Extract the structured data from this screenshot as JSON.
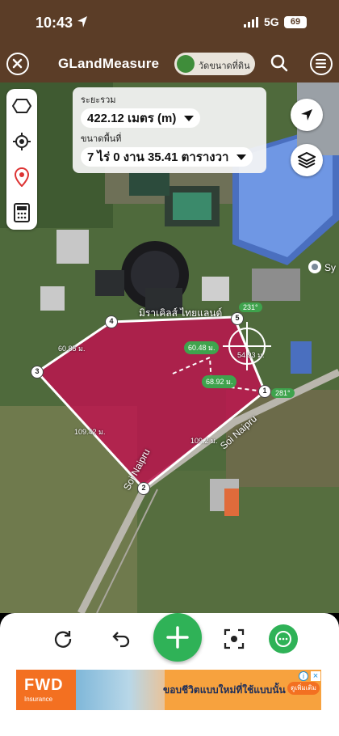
{
  "status": {
    "time": "10:43",
    "network": "5G",
    "battery": "69"
  },
  "app": {
    "title": "GLandMeasure",
    "mode_pill": "วัดขนาดที่ดิน"
  },
  "info_panel": {
    "total_label": "ระยะรวม",
    "total_value": "422.12 เมตร (m)",
    "area_label": "ขนาดพื้นที่",
    "area_value": "7 ไร่ 0 งาน 35.41 ตารางวา"
  },
  "polygon": {
    "vertices": [
      "1",
      "2",
      "3",
      "4",
      "5"
    ],
    "edges": [
      "60.85 ม.",
      "109.42 ม.",
      "109.2 ม.",
      "54.93 ม.",
      "60.48 ม.",
      "68.92 ม."
    ],
    "angles": [
      "281°",
      "231°"
    ]
  },
  "map_labels": {
    "road": "Soi Naipru",
    "road2": "Soi Naipru",
    "place": "มิราเคิลส์ ไทยแลนด์",
    "place2": "Sy"
  },
  "ad": {
    "brand": "FWD",
    "brand_sub": "Insurance",
    "text": "ขอบชีวิตแบบใหม่ที่ใช้แบบนั้น",
    "cta": "ดูเพิ่มเติม"
  },
  "colors": {
    "brown": "#5b3d27",
    "green": "#2fb257",
    "polygon": "#c0114e"
  },
  "icons": [
    "location-arrow-icon",
    "close-icon",
    "search-icon",
    "menu-icon",
    "hexagon-icon",
    "crosshair-icon",
    "pin-icon",
    "calculator-icon",
    "compass-icon",
    "layers-icon",
    "rotate-icon",
    "undo-icon",
    "plus-icon",
    "focus-icon",
    "chat-icon"
  ]
}
